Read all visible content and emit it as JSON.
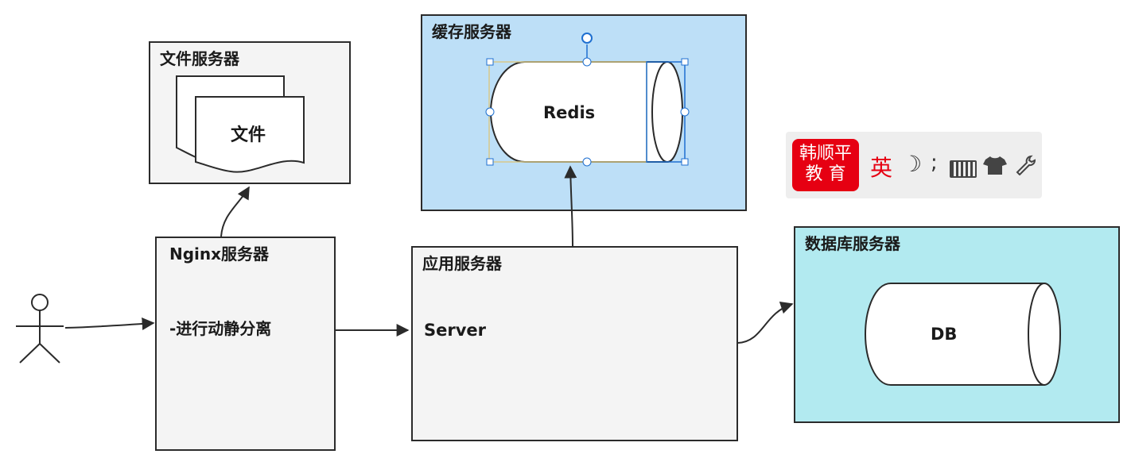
{
  "file_server": {
    "title": "文件服务器",
    "doc_label": "文件"
  },
  "cache_server": {
    "title": "缓存服务器",
    "redis_label": "Redis",
    "bg": "#bddff7"
  },
  "nginx_server": {
    "title": "Nginx服务器",
    "note": "-进行动静分离"
  },
  "app_server": {
    "title": "应用服务器",
    "server_label": "Server"
  },
  "db_server": {
    "title": "数据库服务器",
    "db_label": "DB",
    "bg": "#b2eaf0"
  },
  "ime_toolbar": {
    "logo_line1": "韩顺平",
    "logo_line2": "教 育",
    "lang": "英",
    "punct": ";",
    "icons": [
      "moon-icon",
      "keyboard-icon",
      "shirt-icon",
      "wrench-icon"
    ]
  },
  "actor": {
    "icon": "user-actor-icon"
  }
}
